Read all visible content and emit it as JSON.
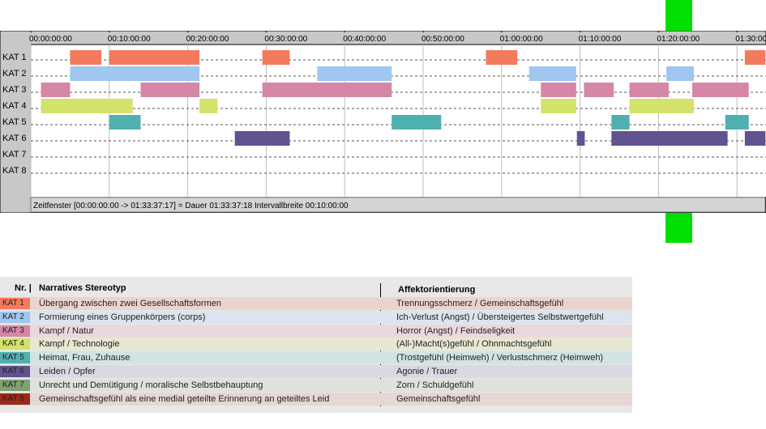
{
  "chart_data": {
    "type": "timeline",
    "rows": [
      "KAT 1",
      "KAT 2",
      "KAT 3",
      "KAT 4",
      "KAT 5",
      "KAT 6",
      "KAT 7",
      "KAT 8"
    ],
    "x_ticks": [
      "00:00:00:00",
      "00:10:00:00",
      "00:20:00:00",
      "00:30:00:00",
      "00:40:00:00",
      "00:50:00:00",
      "01:00:00:00",
      "01:10:00:00",
      "01:20:00:00",
      "01:30:00"
    ],
    "x_range_minutes": [
      0,
      93.627
    ],
    "tick_interval_minutes": 10,
    "status_text": "Zeitfenster [00:00:00:00 -> 01:33:37:17] = Dauer 01:33:37:18     Intervallbreite 00:10:00:00",
    "colors": {
      "KAT 1": "#f47a5c",
      "KAT 2": "#9fc7ef",
      "KAT 3": "#d686a6",
      "KAT 4": "#d3e26a",
      "KAT 5": "#4fb0b0",
      "KAT 6": "#61538f",
      "KAT 7": "#7fa06f",
      "KAT 8": "#9c2a1c"
    },
    "segments": [
      {
        "row": "KAT 1",
        "start": 5.0,
        "end": 9.0
      },
      {
        "row": "KAT 1",
        "start": 10.0,
        "end": 21.5
      },
      {
        "row": "KAT 1",
        "start": 29.5,
        "end": 33.0
      },
      {
        "row": "KAT 1",
        "start": 58.0,
        "end": 62.0
      },
      {
        "row": "KAT 1",
        "start": 91.0,
        "end": 93.627
      },
      {
        "row": "KAT 2",
        "start": 5.0,
        "end": 21.5
      },
      {
        "row": "KAT 2",
        "start": 36.5,
        "end": 46.0
      },
      {
        "row": "KAT 2",
        "start": 63.5,
        "end": 69.5
      },
      {
        "row": "KAT 2",
        "start": 81.0,
        "end": 84.5
      },
      {
        "row": "KAT 3",
        "start": 1.3,
        "end": 5.0
      },
      {
        "row": "KAT 3",
        "start": 14.0,
        "end": 21.5
      },
      {
        "row": "KAT 3",
        "start": 29.5,
        "end": 46.0
      },
      {
        "row": "KAT 3",
        "start": 65.0,
        "end": 69.5
      },
      {
        "row": "KAT 3",
        "start": 70.5,
        "end": 74.3
      },
      {
        "row": "KAT 3",
        "start": 76.3,
        "end": 81.3
      },
      {
        "row": "KAT 3",
        "start": 84.3,
        "end": 91.5
      },
      {
        "row": "KAT 4",
        "start": 1.3,
        "end": 13.0
      },
      {
        "row": "KAT 4",
        "start": 21.5,
        "end": 23.8
      },
      {
        "row": "KAT 4",
        "start": 65.0,
        "end": 69.5
      },
      {
        "row": "KAT 4",
        "start": 76.3,
        "end": 84.5
      },
      {
        "row": "KAT 5",
        "start": 10.0,
        "end": 14.0
      },
      {
        "row": "KAT 5",
        "start": 46.0,
        "end": 52.3
      },
      {
        "row": "KAT 5",
        "start": 74.0,
        "end": 76.3
      },
      {
        "row": "KAT 5",
        "start": 88.5,
        "end": 91.5
      },
      {
        "row": "KAT 6",
        "start": 26.0,
        "end": 33.0
      },
      {
        "row": "KAT 6",
        "start": 69.6,
        "end": 70.6
      },
      {
        "row": "KAT 6",
        "start": 74.0,
        "end": 88.8
      },
      {
        "row": "KAT 6",
        "start": 91.0,
        "end": 93.627
      }
    ],
    "playhead_minutes": 81.3
  },
  "legend": {
    "headers": {
      "nr": "Nr. |",
      "stereotyp": "Narratives Stereotyp",
      "affekt": "Affektorientierung"
    },
    "rows": [
      {
        "kat": "KAT 1",
        "color": "#f47a5c",
        "bg": "#ecd4ce",
        "stereotyp": "Übergang zwischen zwei Gesellschaftsformen",
        "affekt": "Trennungsschmerz / Gemeinschaftsgefühl"
      },
      {
        "kat": "KAT 2",
        "color": "#9fc7ef",
        "bg": "#dde4ef",
        "stereotyp": "Formierung eines Gruppenkörpers (corps)",
        "affekt": "Ich-Verlust (Angst) / Übersteigertes Selbstwertgefühl"
      },
      {
        "kat": "KAT 3",
        "color": "#d686a6",
        "bg": "#ead8de",
        "stereotyp": "Kampf / Natur",
        "affekt": "Horror (Angst) / Feindseligkeit"
      },
      {
        "kat": "KAT 4",
        "color": "#d3e26a",
        "bg": "#e6e8d2",
        "stereotyp": "Kampf / Technologie",
        "affekt": "(All-)Macht(s)gefühl / Ohnmachtsgefühl"
      },
      {
        "kat": "KAT 5",
        "color": "#4fb0b0",
        "bg": "#d2e3e3",
        "stereotyp": "Heimat, Frau, Zuhause",
        "affekt": "(Trostgefühl (Heimweh) / Verlustschmerz (Heimweh)"
      },
      {
        "kat": "KAT 6",
        "color": "#61538f",
        "bg": "#dad8e2",
        "stereotyp": "Leiden / Opfer",
        "affekt": "Agonie / Trauer"
      },
      {
        "kat": "KAT 7",
        "color": "#7fa06f",
        "bg": "#dde2da",
        "stereotyp": "Unrecht und Demütigung / moralische Selbstbehauptung",
        "affekt": "Zorn / Schuldgefühl"
      },
      {
        "kat": "KAT 8",
        "color": "#9c2a1c",
        "bg": "#e6d6d4",
        "stereotyp": "Gemeinschaftsgefühl als eine medial geteilte Erinnerung an geteiltes Leid",
        "affekt": "Gemeinschaftsgefühl"
      }
    ]
  }
}
